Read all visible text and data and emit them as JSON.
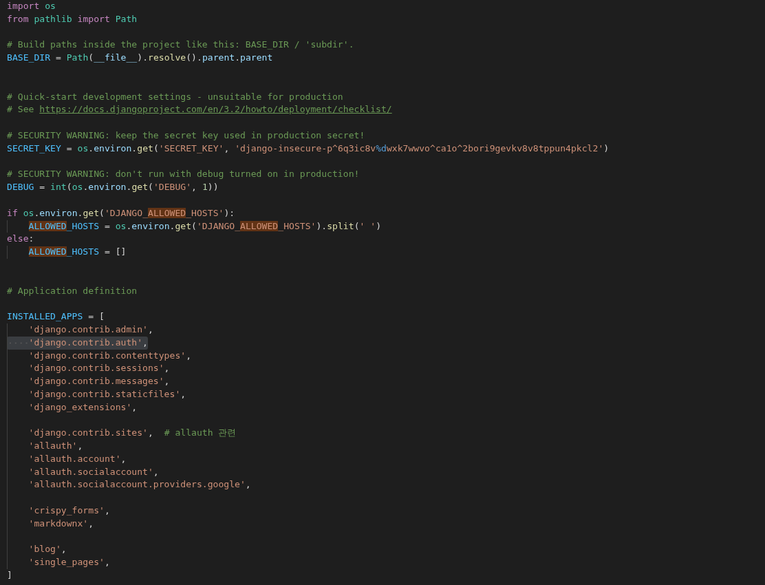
{
  "editor": {
    "lines": [
      {
        "selected": false,
        "indent": false,
        "tokens": [
          {
            "text": "import ",
            "kind": "keyword",
            "match": false
          },
          {
            "text": "os",
            "kind": "module",
            "match": false
          }
        ]
      },
      {
        "selected": false,
        "indent": false,
        "tokens": [
          {
            "text": "from ",
            "kind": "keyword",
            "match": false
          },
          {
            "text": "pathlib ",
            "kind": "module",
            "match": false
          },
          {
            "text": "import ",
            "kind": "keyword",
            "match": false
          },
          {
            "text": "Path",
            "kind": "module",
            "match": false
          }
        ]
      },
      {
        "selected": false,
        "indent": false
      },
      {
        "selected": false,
        "indent": false,
        "tokens": [
          {
            "text": "# Build paths inside the project like this: BASE_DIR / 'subdir'.",
            "kind": "comment",
            "match": false
          }
        ]
      },
      {
        "selected": false,
        "indent": false,
        "tokens": [
          {
            "text": "BASE_DIR",
            "kind": "const",
            "match": false
          },
          {
            "text": " = ",
            "kind": "plain",
            "match": false
          },
          {
            "text": "Path",
            "kind": "module",
            "match": false
          },
          {
            "text": "(",
            "kind": "plain",
            "match": false
          },
          {
            "text": "__file__",
            "kind": "var",
            "match": false
          },
          {
            "text": ").",
            "kind": "plain",
            "match": false
          },
          {
            "text": "resolve",
            "kind": "func",
            "match": false
          },
          {
            "text": "().",
            "kind": "plain",
            "match": false
          },
          {
            "text": "parent",
            "kind": "var",
            "match": false
          },
          {
            "text": ".",
            "kind": "plain",
            "match": false
          },
          {
            "text": "parent",
            "kind": "var",
            "match": false
          }
        ]
      },
      {
        "selected": false,
        "indent": false
      },
      {
        "selected": false,
        "indent": false
      },
      {
        "selected": false,
        "indent": false,
        "tokens": [
          {
            "text": "# Quick-start development settings - unsuitable for production",
            "kind": "comment",
            "match": false
          }
        ]
      },
      {
        "selected": false,
        "indent": false,
        "tokens": [
          {
            "text": "# See ",
            "kind": "comment",
            "match": false
          },
          {
            "text": "https://docs.djangoproject.com/en/3.2/howto/deployment/checklist/",
            "kind": "link",
            "match": false
          }
        ]
      },
      {
        "selected": false,
        "indent": false
      },
      {
        "selected": false,
        "indent": false,
        "tokens": [
          {
            "text": "# SECURITY WARNING: keep the secret key used in production secret!",
            "kind": "comment",
            "match": false
          }
        ]
      },
      {
        "selected": false,
        "indent": false,
        "tokens": [
          {
            "text": "SECRET_KEY",
            "kind": "const",
            "match": false
          },
          {
            "text": " = ",
            "kind": "plain",
            "match": false
          },
          {
            "text": "os",
            "kind": "module",
            "match": false
          },
          {
            "text": ".",
            "kind": "plain",
            "match": false
          },
          {
            "text": "environ",
            "kind": "var",
            "match": false
          },
          {
            "text": ".",
            "kind": "plain",
            "match": false
          },
          {
            "text": "get",
            "kind": "func",
            "match": false
          },
          {
            "text": "(",
            "kind": "plain",
            "match": false
          },
          {
            "text": "'SECRET_KEY'",
            "kind": "string",
            "match": false
          },
          {
            "text": ", ",
            "kind": "plain",
            "match": false
          },
          {
            "text": "'django-insecure-p^6q3ic8v",
            "kind": "string",
            "match": false
          },
          {
            "text": "%d",
            "kind": "format",
            "match": false
          },
          {
            "text": "wxk7wwvo^ca1o^2bori9gevkv8v8tppun4pkcl2'",
            "kind": "string",
            "match": false
          },
          {
            "text": ")",
            "kind": "plain",
            "match": false
          }
        ]
      },
      {
        "selected": false,
        "indent": false
      },
      {
        "selected": false,
        "indent": false,
        "tokens": [
          {
            "text": "# SECURITY WARNING: don't run with debug turned on in production!",
            "kind": "comment",
            "match": false
          }
        ]
      },
      {
        "selected": false,
        "indent": false,
        "tokens": [
          {
            "text": "DEBUG",
            "kind": "const",
            "match": false
          },
          {
            "text": " = ",
            "kind": "plain",
            "match": false
          },
          {
            "text": "int",
            "kind": "module",
            "match": false
          },
          {
            "text": "(",
            "kind": "plain",
            "match": false
          },
          {
            "text": "os",
            "kind": "module",
            "match": false
          },
          {
            "text": ".",
            "kind": "plain",
            "match": false
          },
          {
            "text": "environ",
            "kind": "var",
            "match": false
          },
          {
            "text": ".",
            "kind": "plain",
            "match": false
          },
          {
            "text": "get",
            "kind": "func",
            "match": false
          },
          {
            "text": "(",
            "kind": "plain",
            "match": false
          },
          {
            "text": "'DEBUG'",
            "kind": "string",
            "match": false
          },
          {
            "text": ", ",
            "kind": "plain",
            "match": false
          },
          {
            "text": "1",
            "kind": "number",
            "match": false
          },
          {
            "text": "))",
            "kind": "plain",
            "match": false
          }
        ]
      },
      {
        "selected": false,
        "indent": false
      },
      {
        "selected": false,
        "indent": false,
        "tokens": [
          {
            "text": "if ",
            "kind": "keyword",
            "match": false
          },
          {
            "text": "os",
            "kind": "module",
            "match": false
          },
          {
            "text": ".",
            "kind": "plain",
            "match": false
          },
          {
            "text": "environ",
            "kind": "var",
            "match": false
          },
          {
            "text": ".",
            "kind": "plain",
            "match": false
          },
          {
            "text": "get",
            "kind": "func",
            "match": false
          },
          {
            "text": "(",
            "kind": "plain",
            "match": false
          },
          {
            "text": "'DJANGO_",
            "kind": "string",
            "match": false
          },
          {
            "text": "ALLOWED",
            "kind": "string",
            "match": true
          },
          {
            "text": "_HOSTS'",
            "kind": "string",
            "match": false
          },
          {
            "text": "):",
            "kind": "plain",
            "match": false
          }
        ]
      },
      {
        "selected": false,
        "indent": true,
        "tokens": [
          {
            "text": "ALLOWED",
            "kind": "const",
            "match": true
          },
          {
            "text": "_HOSTS",
            "kind": "const",
            "match": false
          },
          {
            "text": " = ",
            "kind": "plain",
            "match": false
          },
          {
            "text": "os",
            "kind": "module",
            "match": false
          },
          {
            "text": ".",
            "kind": "plain",
            "match": false
          },
          {
            "text": "environ",
            "kind": "var",
            "match": false
          },
          {
            "text": ".",
            "kind": "plain",
            "match": false
          },
          {
            "text": "get",
            "kind": "func",
            "match": false
          },
          {
            "text": "(",
            "kind": "plain",
            "match": false
          },
          {
            "text": "'DJANGO_",
            "kind": "string",
            "match": false
          },
          {
            "text": "ALLOWED",
            "kind": "string",
            "match": true
          },
          {
            "text": "_HOSTS'",
            "kind": "string",
            "match": false
          },
          {
            "text": ").",
            "kind": "plain",
            "match": false
          },
          {
            "text": "split",
            "kind": "func",
            "match": false
          },
          {
            "text": "(",
            "kind": "plain",
            "match": false
          },
          {
            "text": "' '",
            "kind": "string",
            "match": false
          },
          {
            "text": ")",
            "kind": "plain",
            "match": false
          }
        ]
      },
      {
        "selected": false,
        "indent": false,
        "tokens": [
          {
            "text": "else",
            "kind": "keyword",
            "match": false
          },
          {
            "text": ":",
            "kind": "plain",
            "match": false
          }
        ]
      },
      {
        "selected": false,
        "indent": true,
        "tokens": [
          {
            "text": "ALLOWED",
            "kind": "const",
            "match": true
          },
          {
            "text": "_HOSTS",
            "kind": "const",
            "match": false
          },
          {
            "text": " = []",
            "kind": "plain",
            "match": false
          }
        ]
      },
      {
        "selected": false,
        "indent": false
      },
      {
        "selected": false,
        "indent": false
      },
      {
        "selected": false,
        "indent": false,
        "tokens": [
          {
            "text": "# Application definition",
            "kind": "comment",
            "match": false
          }
        ]
      },
      {
        "selected": false,
        "indent": false
      },
      {
        "selected": false,
        "indent": false,
        "tokens": [
          {
            "text": "INSTALLED_APPS",
            "kind": "const",
            "match": false
          },
          {
            "text": " = [",
            "kind": "plain",
            "match": false
          }
        ]
      },
      {
        "selected": false,
        "indent": true,
        "tokens": [
          {
            "text": "'django.contrib.admin'",
            "kind": "string",
            "match": false
          },
          {
            "text": ",",
            "kind": "plain",
            "match": false
          }
        ]
      },
      {
        "selected": true,
        "indent": true,
        "tokens": [
          {
            "text": "'django.contrib.auth'",
            "kind": "string",
            "match": false
          },
          {
            "text": ",",
            "kind": "plain",
            "match": false
          }
        ]
      },
      {
        "selected": false,
        "indent": true,
        "tokens": [
          {
            "text": "'django.contrib.contenttypes'",
            "kind": "string",
            "match": false
          },
          {
            "text": ",",
            "kind": "plain",
            "match": false
          }
        ]
      },
      {
        "selected": false,
        "indent": true,
        "tokens": [
          {
            "text": "'django.contrib.sessions'",
            "kind": "string",
            "match": false
          },
          {
            "text": ",",
            "kind": "plain",
            "match": false
          }
        ]
      },
      {
        "selected": false,
        "indent": true,
        "tokens": [
          {
            "text": "'django.contrib.messages'",
            "kind": "string",
            "match": false
          },
          {
            "text": ",",
            "kind": "plain",
            "match": false
          }
        ]
      },
      {
        "selected": false,
        "indent": true,
        "tokens": [
          {
            "text": "'django.contrib.staticfiles'",
            "kind": "string",
            "match": false
          },
          {
            "text": ",",
            "kind": "plain",
            "match": false
          }
        ]
      },
      {
        "selected": false,
        "indent": true,
        "tokens": [
          {
            "text": "'django_extensions'",
            "kind": "string",
            "match": false
          },
          {
            "text": ",",
            "kind": "plain",
            "match": false
          }
        ]
      },
      {
        "selected": false,
        "indent": true
      },
      {
        "selected": false,
        "indent": true,
        "tokens": [
          {
            "text": "'django.contrib.sites'",
            "kind": "string",
            "match": false
          },
          {
            "text": ",  ",
            "kind": "plain",
            "match": false
          },
          {
            "text": "# allauth 관련",
            "kind": "comment",
            "match": false
          }
        ]
      },
      {
        "selected": false,
        "indent": true,
        "tokens": [
          {
            "text": "'allauth'",
            "kind": "string",
            "match": false
          },
          {
            "text": ",",
            "kind": "plain",
            "match": false
          }
        ]
      },
      {
        "selected": false,
        "indent": true,
        "tokens": [
          {
            "text": "'allauth.account'",
            "kind": "string",
            "match": false
          },
          {
            "text": ",",
            "kind": "plain",
            "match": false
          }
        ]
      },
      {
        "selected": false,
        "indent": true,
        "tokens": [
          {
            "text": "'allauth.socialaccount'",
            "kind": "string",
            "match": false
          },
          {
            "text": ",",
            "kind": "plain",
            "match": false
          }
        ]
      },
      {
        "selected": false,
        "indent": true,
        "tokens": [
          {
            "text": "'allauth.socialaccount.providers.google'",
            "kind": "string",
            "match": false
          },
          {
            "text": ",",
            "kind": "plain",
            "match": false
          }
        ]
      },
      {
        "selected": false,
        "indent": true
      },
      {
        "selected": false,
        "indent": true,
        "tokens": [
          {
            "text": "'crispy_forms'",
            "kind": "string",
            "match": false
          },
          {
            "text": ",",
            "kind": "plain",
            "match": false
          }
        ]
      },
      {
        "selected": false,
        "indent": true,
        "tokens": [
          {
            "text": "'markdownx'",
            "kind": "string",
            "match": false
          },
          {
            "text": ",",
            "kind": "plain",
            "match": false
          }
        ]
      },
      {
        "selected": false,
        "indent": true
      },
      {
        "selected": false,
        "indent": true,
        "tokens": [
          {
            "text": "'blog'",
            "kind": "string",
            "match": false
          },
          {
            "text": ",",
            "kind": "plain",
            "match": false
          }
        ]
      },
      {
        "selected": false,
        "indent": true,
        "tokens": [
          {
            "text": "'single_pages'",
            "kind": "string",
            "match": false
          },
          {
            "text": ",",
            "kind": "plain",
            "match": false
          }
        ]
      },
      {
        "selected": false,
        "indent": false,
        "tokens": [
          {
            "text": "]",
            "kind": "plain",
            "match": false
          }
        ]
      }
    ]
  }
}
